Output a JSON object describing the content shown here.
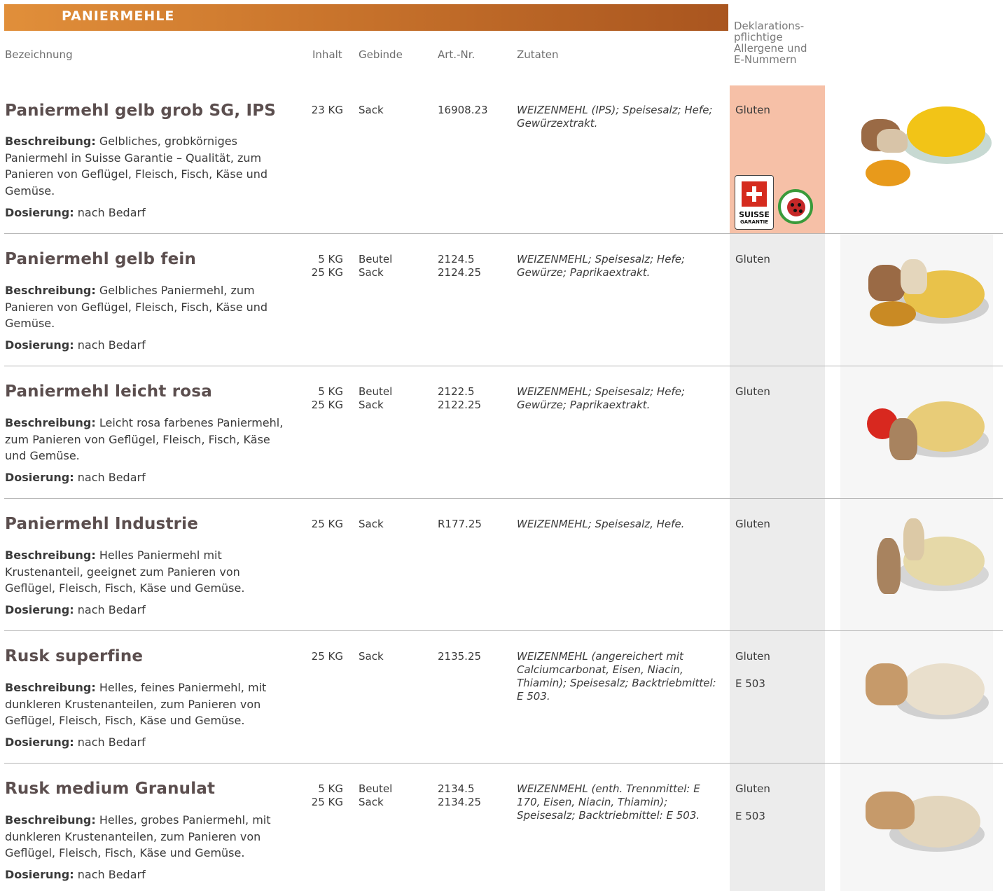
{
  "header": {
    "title": "PANIERMEHLE",
    "columns": {
      "bezeichnung": "Bezeichnung",
      "inhalt": "Inhalt",
      "gebinde": "Gebinde",
      "artnr": "Art.-Nr.",
      "zutaten": "Zutaten",
      "allergene": "Deklarations-\npflichtige\nAllergene und\nE-Nummern"
    }
  },
  "labels": {
    "beschreibung": "Beschreibung:",
    "dosierung": "Dosierung:"
  },
  "badges": {
    "suisse_garantie_line1": "SUISSE",
    "suisse_garantie_line2": "GARANTIE",
    "ip_suisse_icon": "ladybug-icon",
    "highlight_color": "#f6c0a7"
  },
  "products": [
    {
      "name": "Paniermehl gelb grob SG, IPS",
      "description": "Gelbliches, grobkörniges Paniermehl in Suisse Garantie – Qualität, zum Panieren von Geflügel, Fleisch, Fisch, Käse und Gemüse.",
      "dosage": "nach Bedarf",
      "inhalt": "23 KG",
      "gebinde": "Sack",
      "artnr": "16908.23",
      "zutaten": "WEIZENMEHL (IPS); Speisesalz; Hefe; Gewürzextrakt.",
      "allergene": "Gluten",
      "e_nummern": "",
      "image": "breadcrumbs-yellow-coarse-photo"
    },
    {
      "name": "Paniermehl gelb fein",
      "description": "Gelbliches Paniermehl, zum Panieren von Geflügel, Fleisch, Fisch, Käse und Gemüse.",
      "dosage": "nach Bedarf",
      "inhalt": "5 KG\n25 KG",
      "gebinde": "Beutel\nSack",
      "artnr": "2124.5\n2124.25",
      "zutaten": "WEIZENMEHL; Speisesalz; Hefe; Gewürze; Paprikaextrakt.",
      "allergene": "Gluten",
      "e_nummern": "",
      "image": "breadcrumbs-yellow-fine-photo"
    },
    {
      "name": "Paniermehl leicht rosa",
      "description": "Leicht rosa farbenes Paniermehl, zum Panieren von Geflügel, Fleisch, Fisch, Käse und Gemüse.",
      "dosage": "nach Bedarf",
      "inhalt": "5 KG\n25 KG",
      "gebinde": "Beutel\nSack",
      "artnr": "2122.5\n2122.25",
      "zutaten": "WEIZENMEHL; Speisesalz; Hefe; Gewürze; Paprikaextrakt.",
      "allergene": "Gluten",
      "e_nummern": "",
      "image": "breadcrumbs-pink-photo"
    },
    {
      "name": "Paniermehl Industrie",
      "description": "Helles Paniermehl mit Krustenanteil, geeignet zum Panieren von Geflügel, Fleisch, Fisch, Käse und Gemüse.",
      "dosage": "nach Bedarf",
      "inhalt": "25 KG",
      "gebinde": "Sack",
      "artnr": "R177.25",
      "zutaten": "WEIZENMEHL; Speisesalz, Hefe.",
      "allergene": "Gluten",
      "e_nummern": "",
      "image": "breadcrumbs-industrial-photo"
    },
    {
      "name": "Rusk superfine",
      "description": "Helles, feines Paniermehl, mit dunkleren Krustenanteilen, zum Panieren von Geflügel, Fleisch, Fisch, Käse und Gemüse.",
      "dosage": "nach Bedarf",
      "inhalt": "25 KG",
      "gebinde": "Sack",
      "artnr": "2135.25",
      "zutaten": "WEIZENMEHL (angereichert mit Calciumcarbonat, Eisen, Niacin, Thiamin); Speisesalz; Backtriebmittel: E 503.",
      "allergene": "Gluten",
      "e_nummern": "E 503",
      "image": "rusk-superfine-photo"
    },
    {
      "name": "Rusk medium Granulat",
      "description": "Helles, grobes Paniermehl, mit dunkleren Krustenanteilen, zum Panieren von Geflügel, Fleisch, Fisch, Käse und Gemüse.",
      "dosage": "nach Bedarf",
      "inhalt": "5 KG\n25 KG",
      "gebinde": "Beutel\nSack",
      "artnr": "2134.5\n2134.25",
      "zutaten": "WEIZENMEHL (enth. Trennmittel: E 170, Eisen, Niacin, Thiamin); Speisesalz; Backtriebmittel: E 503.",
      "allergene": "Gluten",
      "e_nummern": "E 503",
      "image": "rusk-medium-granulat-photo"
    }
  ]
}
